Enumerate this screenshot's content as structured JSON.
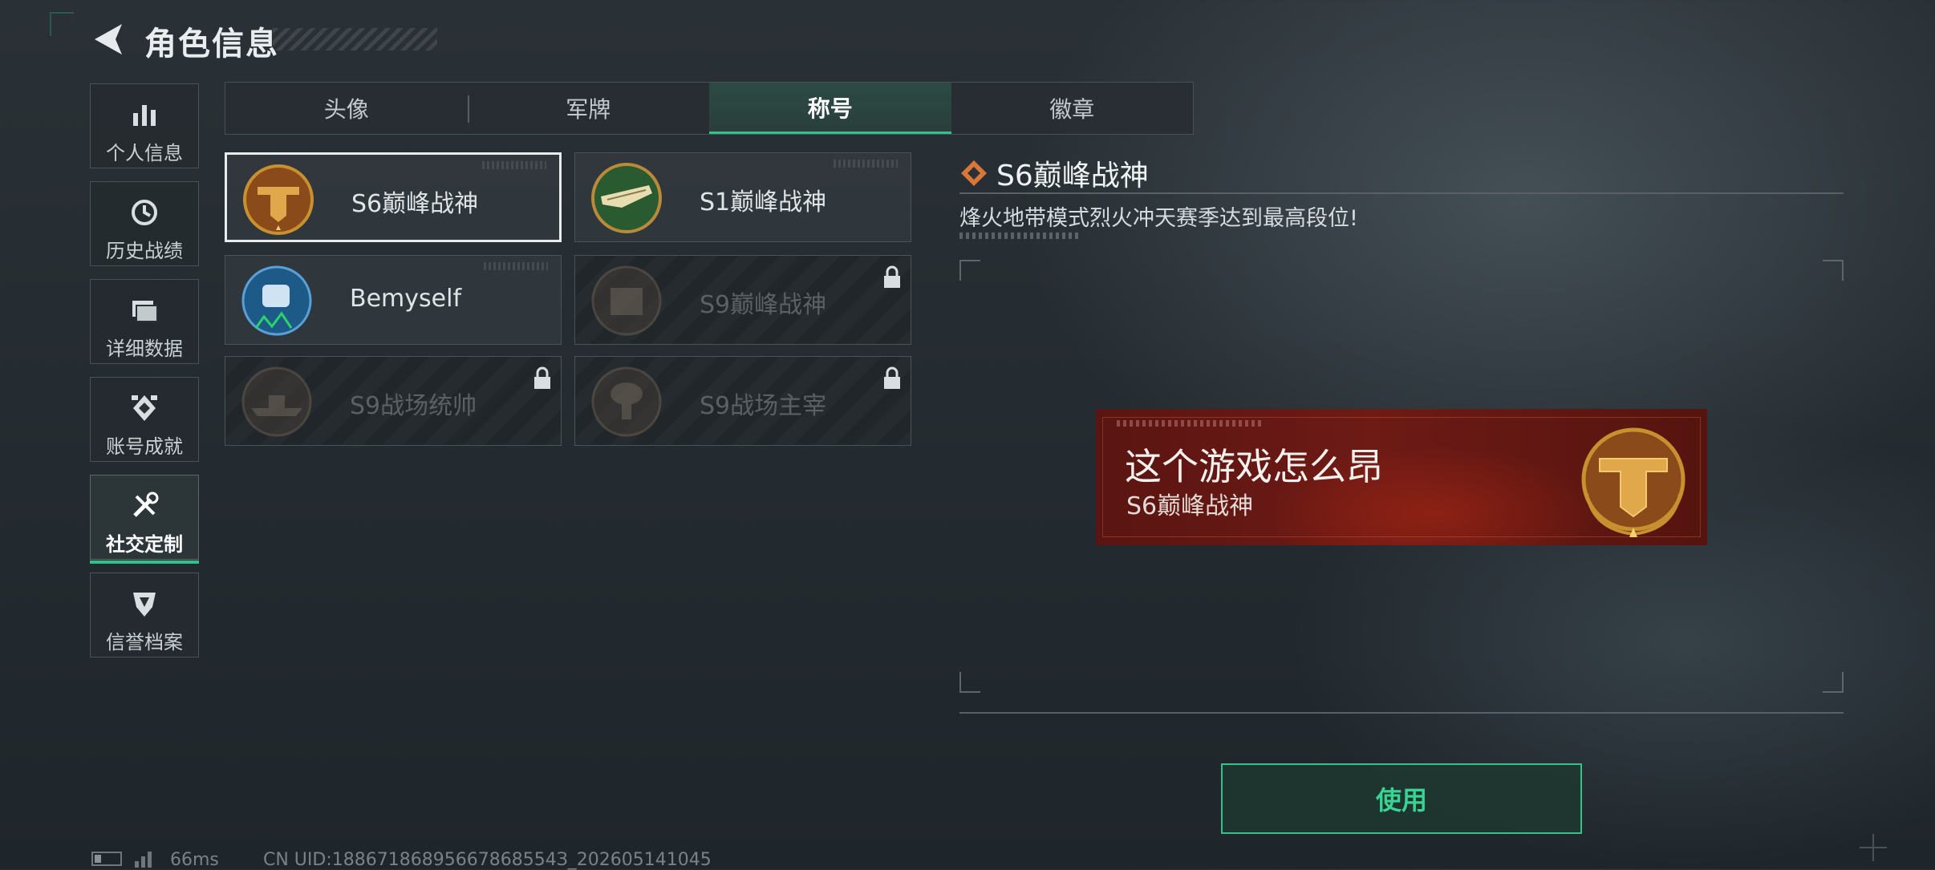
{
  "header": {
    "title": "角色信息"
  },
  "sidebar": {
    "items": [
      {
        "label": "个人信息",
        "icon": "bar-chart-icon",
        "active": false
      },
      {
        "label": "历史战绩",
        "icon": "history-clock-icon",
        "active": false
      },
      {
        "label": "详细数据",
        "icon": "folder-icon",
        "active": false
      },
      {
        "label": "账号成就",
        "icon": "achievement-icon",
        "active": false
      },
      {
        "label": "社交定制",
        "icon": "tools-icon",
        "active": true
      },
      {
        "label": "信誉档案",
        "icon": "shield-icon",
        "active": false
      }
    ]
  },
  "tabs": [
    {
      "label": "头像",
      "active": false
    },
    {
      "label": "军牌",
      "active": false
    },
    {
      "label": "称号",
      "active": true
    },
    {
      "label": "徽章",
      "active": false
    }
  ],
  "titles": [
    {
      "name": "S6巅峰战神",
      "emblem": "s6-gold-emblem",
      "selected": true,
      "locked": false
    },
    {
      "name": "S1巅峰战神",
      "emblem": "crocodile-emblem",
      "selected": false,
      "locked": false
    },
    {
      "name": "Bemyself",
      "emblem": "blue-soldier-emblem",
      "selected": false,
      "locked": false
    },
    {
      "name": "S9巅峰战神",
      "emblem": "fortress-emblem",
      "selected": false,
      "locked": true
    },
    {
      "name": "S9战场统帅",
      "emblem": "battleship-emblem",
      "selected": false,
      "locked": true
    },
    {
      "name": "S9战场主宰",
      "emblem": "mushroom-cloud-emblem",
      "selected": false,
      "locked": true
    }
  ],
  "detail": {
    "title": "S6巅峰战神",
    "description": "烽火地带模式烈火冲天赛季达到最高段位!"
  },
  "preview": {
    "player_name": "这个游戏怎么昂",
    "title": "S6巅峰战神"
  },
  "use_button": {
    "label": "使用"
  },
  "status": {
    "ping": "66ms",
    "uid": "CN UID:18867186895667868554З_202605141045"
  },
  "colors": {
    "accent": "#35c18a",
    "banner_red": "#6e1a15",
    "emblem_gold": "#c8902e"
  }
}
